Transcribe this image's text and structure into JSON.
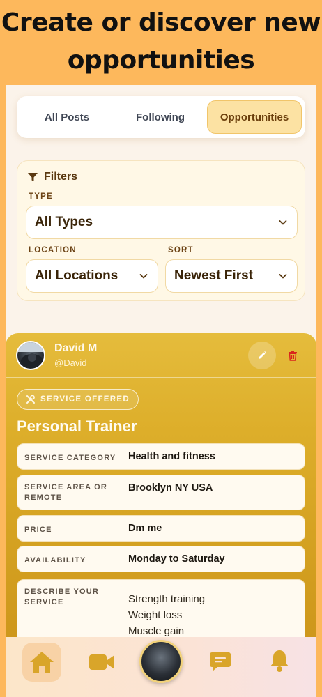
{
  "headline": "Create or discover new opportunities",
  "tabs": [
    {
      "label": "All Posts"
    },
    {
      "label": "Following"
    },
    {
      "label": "Opportunities"
    }
  ],
  "filters": {
    "title": "Filters",
    "type_label": "TYPE",
    "type_value": "All Types",
    "location_label": "LOCATION",
    "location_value": "All Locations",
    "sort_label": "SORT",
    "sort_value": "Newest First"
  },
  "post": {
    "user_name": "David M",
    "user_handle": "@David",
    "badge": "SERVICE OFFERED",
    "title": "Personal Trainer",
    "fields": [
      {
        "label": "SERVICE CATEGORY",
        "value": "Health and fitness"
      },
      {
        "label": "SERVICE AREA OR REMOTE",
        "value": "Brooklyn NY USA"
      },
      {
        "label": "PRICE",
        "value": "Dm me"
      },
      {
        "label": "AVAILABILITY",
        "value": "Monday to Saturday"
      },
      {
        "label": "DESCRIBE YOUR SERVICE",
        "lines": [
          "Strength training",
          "Weight loss",
          "Muscle gain"
        ]
      }
    ]
  },
  "nav": {
    "icons": [
      "home-icon",
      "video-camera-icon",
      "profile-avatar",
      "chat-icon",
      "bell-icon"
    ]
  },
  "colors": {
    "page_bg": "#FDB85C",
    "accent": "#DDAE2A",
    "active_tab": "#FCE2A3",
    "delete": "#D9261C",
    "nav_icon": "#D9A52A"
  }
}
